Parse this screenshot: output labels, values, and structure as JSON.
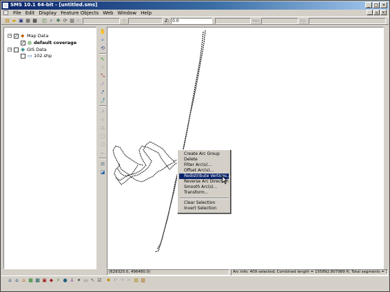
{
  "window": {
    "title": "SMS 10.1 64-bit - [untitled.sms]"
  },
  "menu": {
    "items": [
      "File",
      "Edit",
      "Display",
      "Feature Objects",
      "Web",
      "Window",
      "Help"
    ]
  },
  "toolbar": {
    "coord_labels": [
      "X:",
      "Y:",
      "Z:",
      "Vel:",
      "Vy:"
    ],
    "z_value": "0.0"
  },
  "tree": {
    "map_data": "Map Data",
    "default_coverage": "default coverage",
    "gis_data": "GIS Data",
    "shapefile": "102.shp"
  },
  "context_menu": {
    "items": [
      "Create Arc Group",
      "Delete",
      "Filter Arc(s)...",
      "Offset Arc(s)...",
      "Redistribute Vertices...",
      "Reverse Arc Direction",
      "Smooth Arc(s)...",
      "Transform...",
      "Clear Selection",
      "Invert Selection"
    ],
    "highlighted": "Redistribute Vertices..."
  },
  "status": {
    "cursor_coords": "(629320.0, 496480.0)",
    "arc_info": "Arc info: 409 selected; Combined length = 155892.807989 ft; Total segments = 3853."
  },
  "colors": {
    "title_start": "#0a246a",
    "title_end": "#a6caf0",
    "chrome": "#d4d0c8",
    "highlight": "#0a246a"
  },
  "icons": {
    "toolbar": [
      "new-file-icon",
      "open-folder-icon",
      "save-icon",
      "print-icon",
      "delete-icon",
      "frame-icon",
      "zoom-icon",
      "pan-icon",
      "rotate-icon"
    ],
    "toolbox": [
      "pan-icon",
      "zoom-icon",
      "rotate-icon",
      "select-point-icon",
      "select-vertex-icon",
      "create-arc-icon",
      "select-arc-icon",
      "create-polygon-icon",
      "select-polygon-icon"
    ]
  }
}
